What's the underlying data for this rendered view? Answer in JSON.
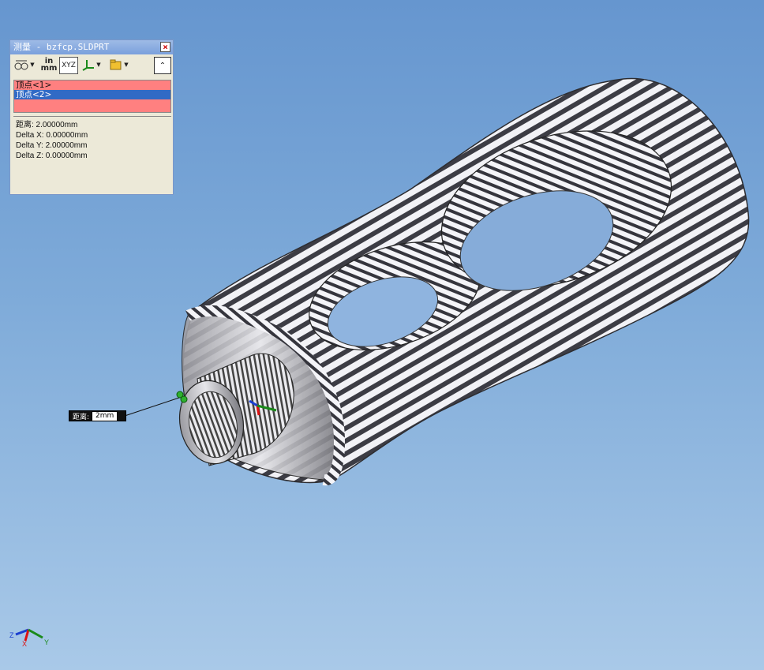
{
  "window": {
    "title": "测量 - bzfcp.SLDPRT"
  },
  "toolbar": {
    "units_top": "in",
    "units_bottom": "mm",
    "xyz_label": "XYZ"
  },
  "selections": [
    {
      "label": "顶点<1>",
      "selected": false
    },
    {
      "label": "顶点<2>",
      "selected": true
    }
  ],
  "results": [
    "距离: 2.00000mm",
    "Delta X: 0.00000mm",
    "Delta Y: 2.00000mm",
    "Delta Z: 0.00000mm"
  ],
  "callout": {
    "label": "距离:",
    "value": "2mm"
  },
  "triad": {
    "x": "X",
    "y": "Y",
    "z": "Z"
  },
  "colors": {
    "background_top": "#6696cf",
    "background_bottom": "#a9c9e8",
    "selection_list": "#ff8080",
    "selected_row": "#316ac5"
  }
}
